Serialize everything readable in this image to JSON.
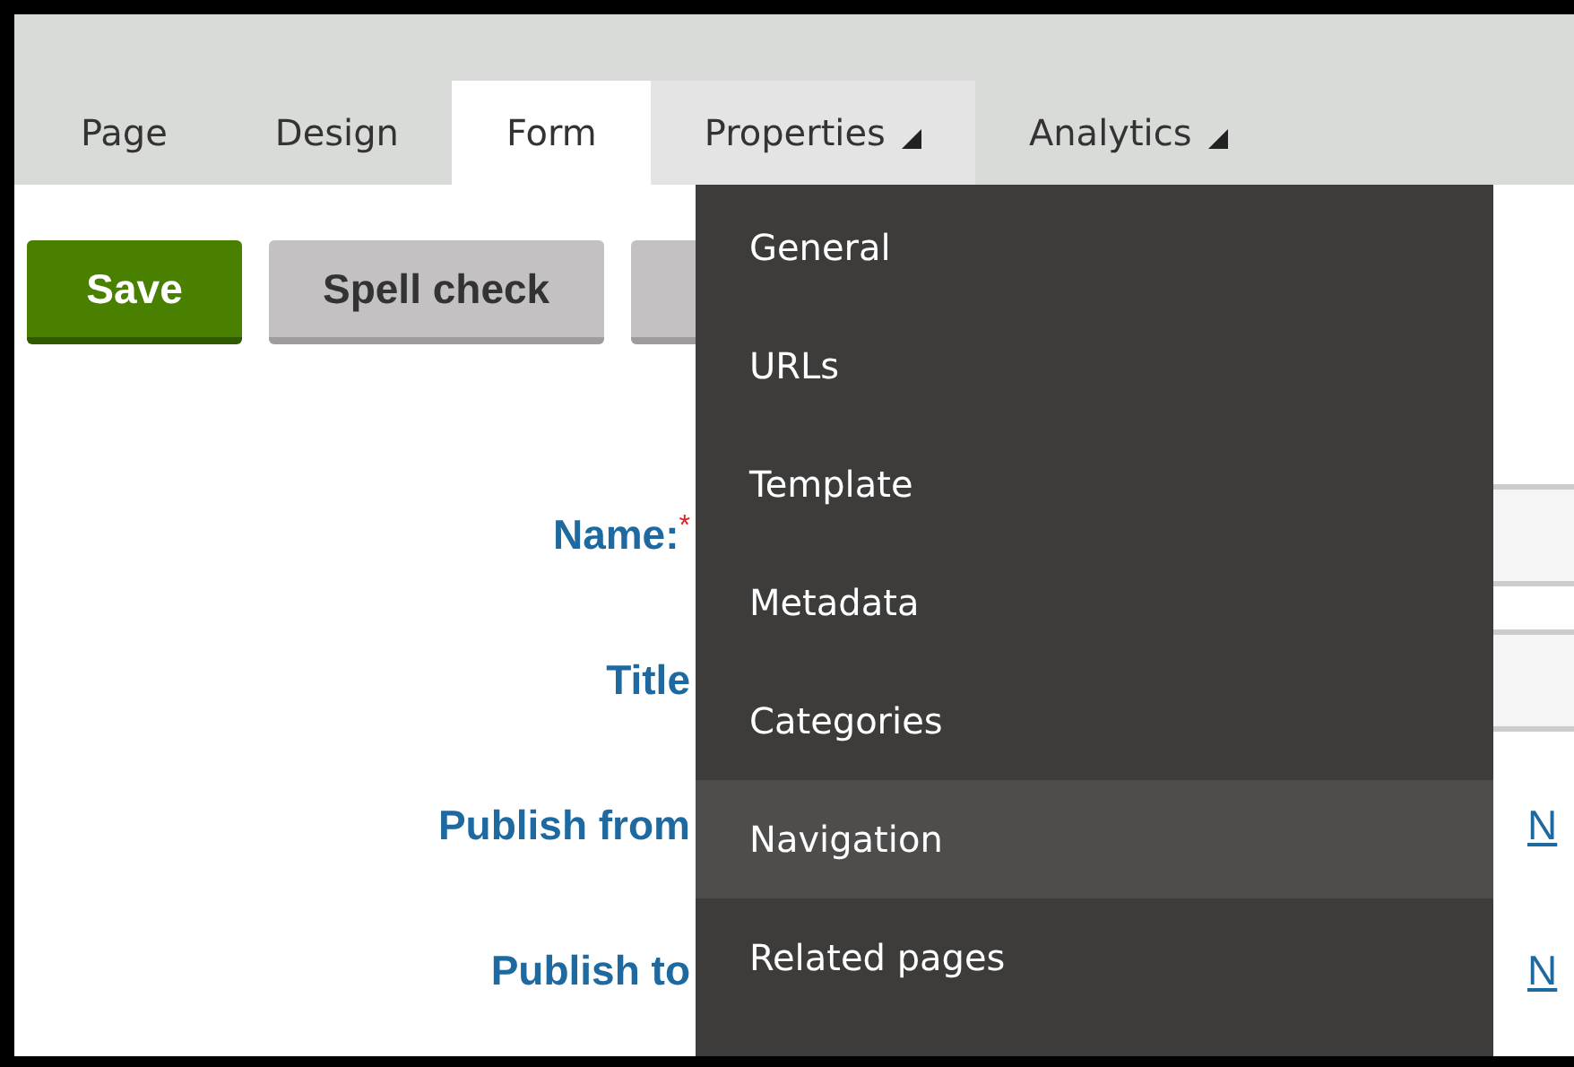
{
  "tabs": [
    {
      "label": "Page",
      "selected": false,
      "has_menu": false,
      "open": false
    },
    {
      "label": "Design",
      "selected": false,
      "has_menu": false,
      "open": false
    },
    {
      "label": "Form",
      "selected": true,
      "has_menu": false,
      "open": false
    },
    {
      "label": "Properties",
      "selected": false,
      "has_menu": true,
      "open": true
    },
    {
      "label": "Analytics",
      "selected": false,
      "has_menu": true,
      "open": false
    }
  ],
  "toolbar": {
    "buttons": [
      {
        "label": "Save",
        "kind": "primary"
      },
      {
        "label": "Spell check",
        "kind": "secondary"
      },
      {
        "kind": "secondary"
      }
    ]
  },
  "form": {
    "rows": [
      {
        "label": "Name:",
        "required_mark": "*",
        "kind": "input"
      },
      {
        "label": "Title",
        "kind": "input"
      },
      {
        "label": "Publish from",
        "kind": "link",
        "link": "N"
      },
      {
        "label": "Publish to",
        "kind": "link",
        "link": "N"
      }
    ]
  },
  "menu": {
    "items": [
      {
        "label": "General",
        "selected": false
      },
      {
        "label": "URLs",
        "selected": false
      },
      {
        "label": "Template",
        "selected": false
      },
      {
        "label": "Metadata",
        "selected": false
      },
      {
        "label": "Categories",
        "selected": false
      },
      {
        "label": "Navigation",
        "selected": true
      },
      {
        "label": "Related pages",
        "selected": false
      }
    ]
  }
}
